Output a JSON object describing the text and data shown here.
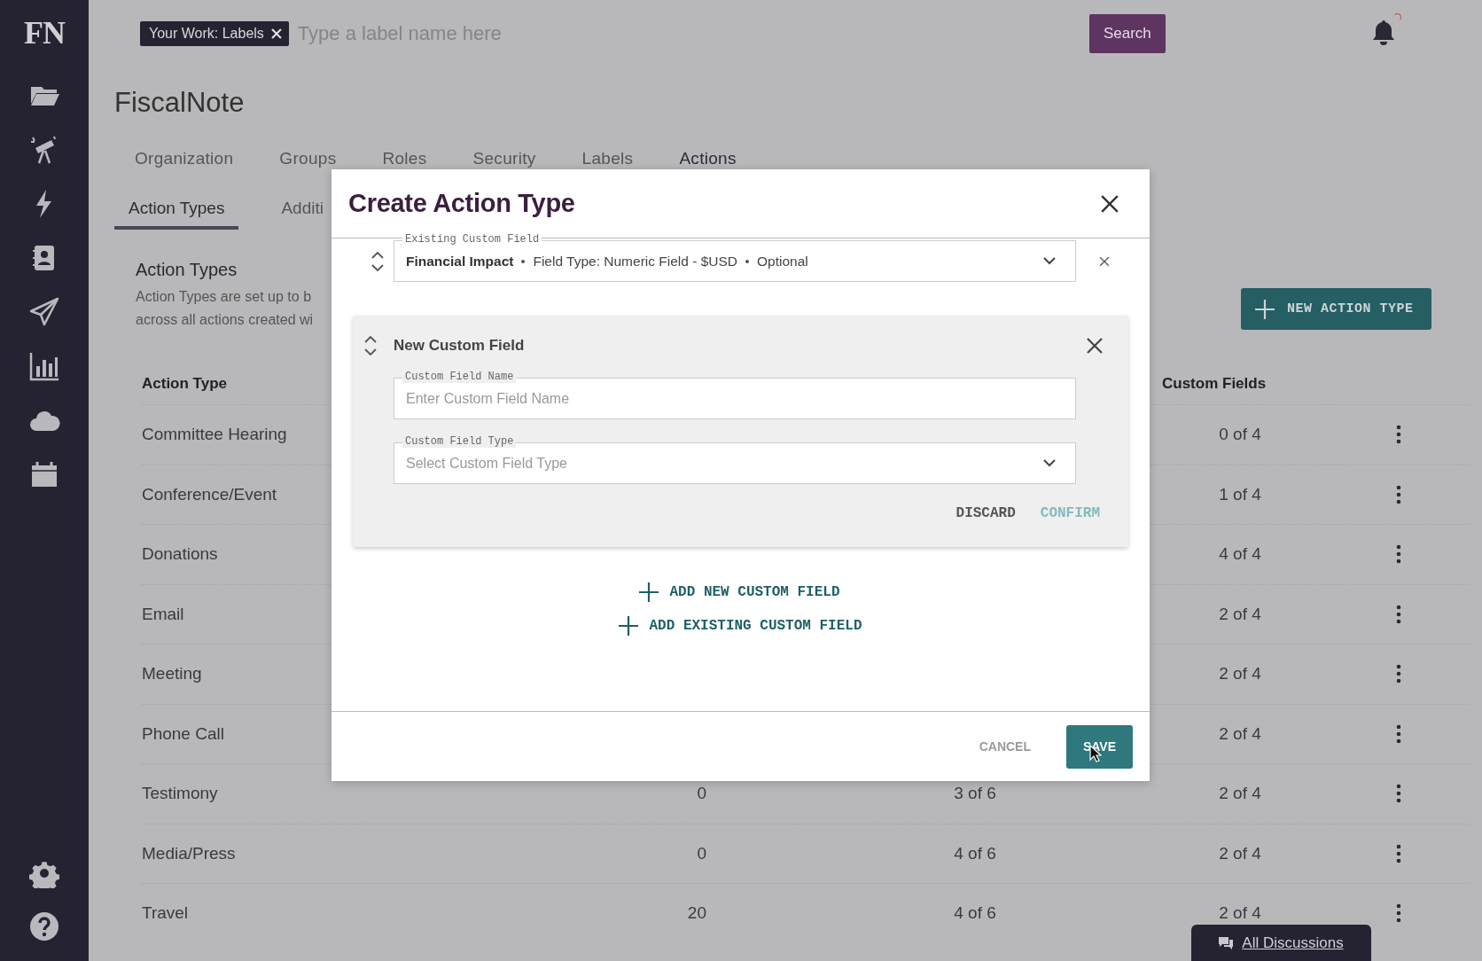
{
  "sidebar": {
    "logo": "FN"
  },
  "top_bar": {
    "filter_chip": "Your Work: Labels",
    "search": {
      "placeholder": "Type a label name here"
    },
    "search_button": "Search",
    "notification_badge": true
  },
  "page_title": "FiscalNote",
  "tabs": [
    {
      "label": "Organization",
      "selected": false
    },
    {
      "label": "Groups",
      "selected": false
    },
    {
      "label": "Roles",
      "selected": false
    },
    {
      "label": "Security",
      "selected": false
    },
    {
      "label": "Labels",
      "selected": false
    },
    {
      "label": "Actions",
      "selected": true
    }
  ],
  "subtabs": [
    {
      "label": "Action Types",
      "selected": true
    },
    {
      "label": "Additi",
      "selected": false
    }
  ],
  "section": {
    "title": "Action Types",
    "description_lines": [
      "Action Types are set up to b",
      "across all actions created wi"
    ]
  },
  "new_button": "NEW ACTION TYPE",
  "table": {
    "header": {
      "action_type": "Action Type",
      "custom_fields": "Custom Fields"
    },
    "rows": [
      {
        "action_type": "Committee Hearing",
        "custom_fields": "0 of 4"
      },
      {
        "action_type": "Conference/Event",
        "custom_fields": "1 of 4"
      },
      {
        "action_type": "Donations",
        "custom_fields": "4 of 4"
      },
      {
        "action_type": "Email",
        "custom_fields": "2 of 4"
      },
      {
        "action_type": "Meeting",
        "custom_fields": "2 of 4"
      },
      {
        "action_type": "Phone Call",
        "custom_fields": "2 of 4"
      },
      {
        "action_type": "Testimony",
        "column_2": "0",
        "column_3": "3 of 6",
        "custom_fields": "2 of 4"
      },
      {
        "action_type": "Media/Press",
        "column_2": "0",
        "column_3": "4 of 6",
        "custom_fields": "2 of 4"
      },
      {
        "action_type": "Travel",
        "column_2": "20",
        "column_3": "4 of 6",
        "custom_fields": "2 of 4"
      }
    ]
  },
  "discussions_tab": "All Discussions",
  "modal": {
    "title": "Create Action Type",
    "existing_field": {
      "label": "Existing Custom Field",
      "name": "Financial Impact",
      "details": [
        "Field Type: Numeric Field - $USD",
        "Optional"
      ]
    },
    "new_field": {
      "title": "New Custom Field",
      "inputs": [
        {
          "kind": "text",
          "label": "Custom Field Name",
          "placeholder": "Enter Custom Field Name"
        },
        {
          "kind": "select",
          "label": "Custom Field Type",
          "placeholder": "Select Custom Field Type"
        }
      ],
      "actions": [
        {
          "label": "DISCARD",
          "disabled": false
        },
        {
          "label": "CONFIRM",
          "disabled": true
        }
      ]
    },
    "add_links": [
      "ADD NEW CUSTOM FIELD",
      "ADD EXISTING CUSTOM FIELD"
    ],
    "footer": {
      "cancel": "CANCEL",
      "save": "SAVE"
    }
  }
}
